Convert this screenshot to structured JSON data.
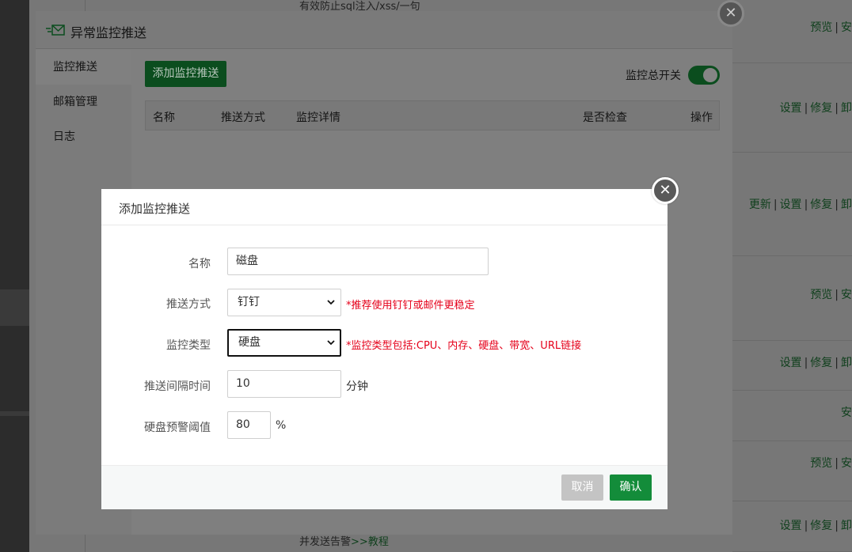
{
  "background": {
    "top_text": "有效防止sql注入/xss/一句",
    "bottom_text": "并发送告警",
    "bottom_arrow": ">>",
    "bottom_link": "教程",
    "rows": [
      {
        "links": [
          "预览",
          "安"
        ]
      },
      {
        "links": [
          "设置",
          "修复",
          "卸"
        ]
      },
      {
        "links": [
          "更新",
          "设置",
          "修复",
          "卸"
        ]
      },
      {
        "links": [
          "预览",
          "安"
        ]
      },
      {
        "links": [
          "设置",
          "修复",
          "卸"
        ]
      },
      {
        "links": [
          "安"
        ]
      },
      {
        "links": [
          "预览",
          "安"
        ]
      },
      {
        "links": [
          "设置",
          "修复",
          "卸"
        ]
      }
    ]
  },
  "window": {
    "title": "异常监控推送",
    "close_glyph": "✕",
    "sidebar": [
      {
        "label": "监控推送",
        "active": true
      },
      {
        "label": "邮箱管理",
        "active": false
      },
      {
        "label": "日志",
        "active": false
      }
    ],
    "add_button": "添加监控推送",
    "master_switch_label": "监控总开关",
    "master_switch_on": true,
    "table_headers": [
      "名称",
      "推送方式",
      "监控详情",
      "是否检查",
      "操作"
    ]
  },
  "modal": {
    "title": "添加监控推送",
    "close_glyph": "✕",
    "fields": {
      "name": {
        "label": "名称",
        "value": "磁盘"
      },
      "push_method": {
        "label": "推送方式",
        "value": "钉钉",
        "hint": "*推荐使用钉钉或邮件更稳定"
      },
      "monitor_type": {
        "label": "监控类型",
        "value": "硬盘",
        "hint": "*监控类型包括:CPU、内存、硬盘、带宽、URL链接"
      },
      "interval": {
        "label": "推送间隔时间",
        "value": "10",
        "unit": "分钟"
      },
      "threshold": {
        "label": "硬盘预警阈值",
        "value": "80",
        "unit": "%"
      }
    },
    "cancel_label": "取消",
    "confirm_label": "确认"
  },
  "colors": {
    "accent": "#138c3a",
    "hint_red": "#e5001a",
    "cancel_gray": "#c4c4c4"
  }
}
